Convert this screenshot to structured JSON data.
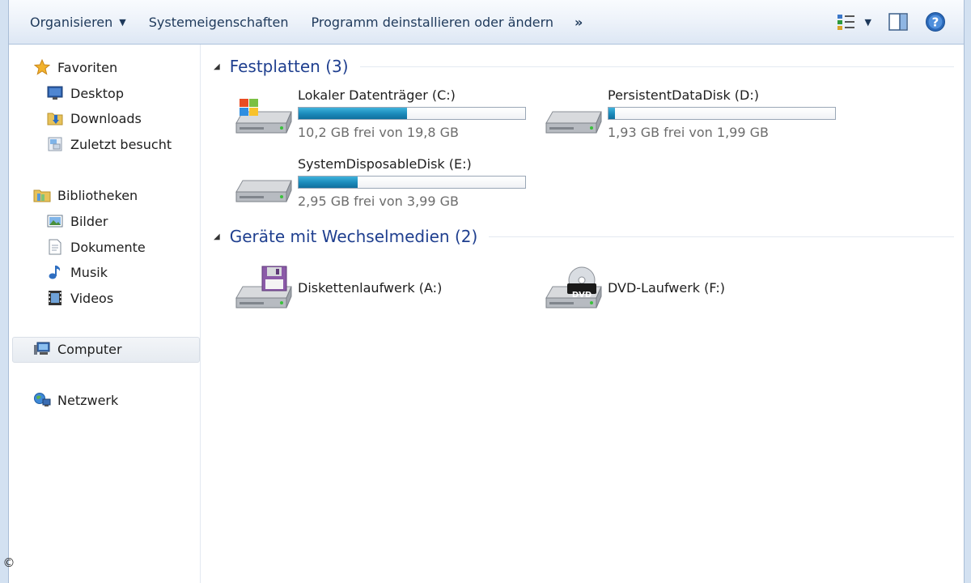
{
  "toolbar": {
    "organize": "Organisieren",
    "system_props": "Systemeigenschaften",
    "uninstall": "Programm deinstallieren oder ändern",
    "more": "»"
  },
  "nav": {
    "favorites": {
      "label": "Favoriten",
      "items": [
        {
          "label": "Desktop",
          "icon": "desktop-icon"
        },
        {
          "label": "Downloads",
          "icon": "downloads-folder-icon"
        },
        {
          "label": "Zuletzt besucht",
          "icon": "recent-places-icon"
        }
      ]
    },
    "libraries": {
      "label": "Bibliotheken",
      "items": [
        {
          "label": "Bilder",
          "icon": "pictures-icon"
        },
        {
          "label": "Dokumente",
          "icon": "documents-icon"
        },
        {
          "label": "Musik",
          "icon": "music-note-icon"
        },
        {
          "label": "Videos",
          "icon": "video-film-icon"
        }
      ]
    },
    "computer": "Computer",
    "network": "Netzwerk"
  },
  "groups": {
    "hard_disks": {
      "title": "Festplatten (3)",
      "drives": [
        {
          "name": "Lokaler Datenträger (C:)",
          "free_text": "10,2 GB frei von 19,8 GB",
          "used_fraction": 0.48
        },
        {
          "name": "PersistentDataDisk (D:)",
          "free_text": "1,93 GB frei von 1,99 GB",
          "used_fraction": 0.03
        },
        {
          "name": "SystemDisposableDisk (E:)",
          "free_text": "2,95 GB frei von 3,99 GB",
          "used_fraction": 0.26
        }
      ]
    },
    "removable": {
      "title": "Geräte mit Wechselmedien (2)",
      "devices": [
        {
          "name": "Diskettenlaufwerk (A:)",
          "icon": "floppy-drive-icon"
        },
        {
          "name": "DVD-Laufwerk (F:)",
          "icon": "dvd-drive-icon",
          "badge": "DVD"
        }
      ]
    }
  },
  "colors": {
    "group_title": "#1f3f8f",
    "bar_fill": "#1d8dbd",
    "selection": "#e6ebf1"
  },
  "footer": {
    "copyright_symbol": "©"
  }
}
